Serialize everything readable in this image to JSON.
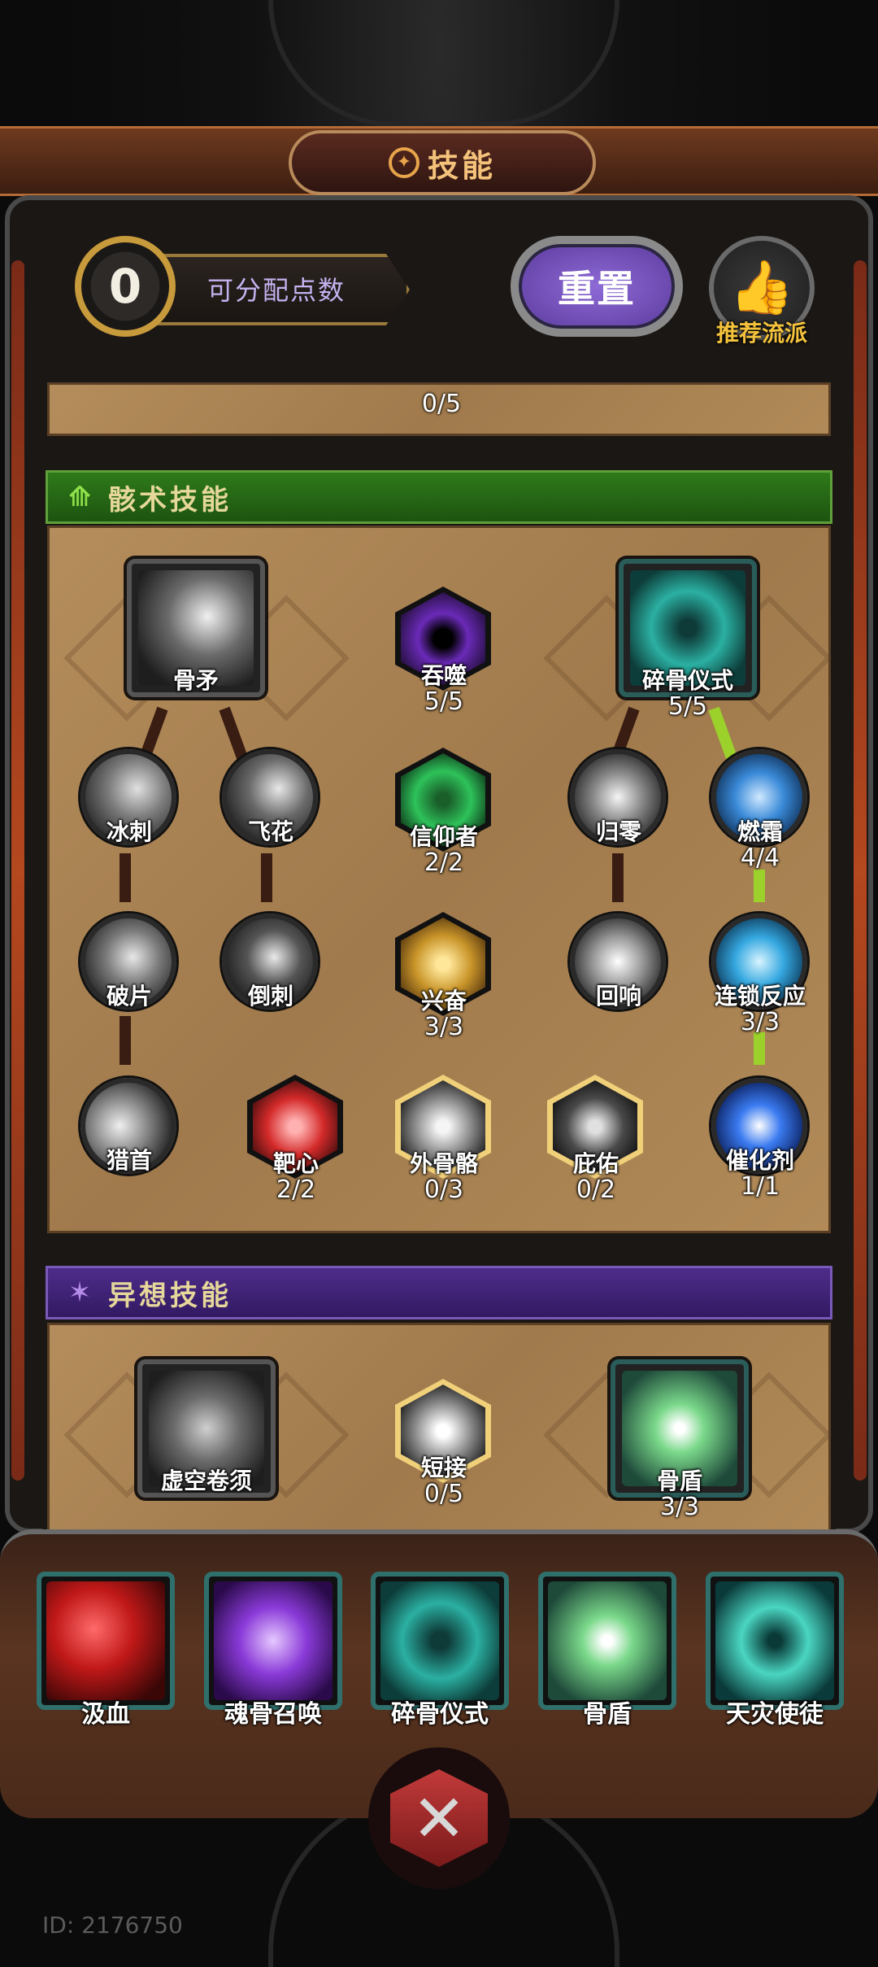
{
  "header": {
    "title": "技能",
    "title_icon": "pentagram-icon",
    "points_value": "0",
    "points_label": "可分配点数",
    "reset_label": "重置",
    "recommend_label": "推荐流派"
  },
  "top_strip": {
    "level": "0/5"
  },
  "sections": {
    "bone": {
      "title": "骸术技能",
      "color": "#2f7a1a",
      "nodes": {
        "bone_spear": {
          "name": "骨矛"
        },
        "devour": {
          "name": "吞噬",
          "level": "5/5"
        },
        "bone_ritual": {
          "name": "碎骨仪式",
          "level": "5/5"
        },
        "ice_spike": {
          "name": "冰刺"
        },
        "flying_flower": {
          "name": "飞花"
        },
        "believer": {
          "name": "信仰者",
          "level": "2/2"
        },
        "return_zero": {
          "name": "归零"
        },
        "burning_frost": {
          "name": "燃霜",
          "level": "4/4"
        },
        "shard": {
          "name": "破片"
        },
        "barb": {
          "name": "倒刺"
        },
        "excite": {
          "name": "兴奋",
          "level": "3/3"
        },
        "echo": {
          "name": "回响"
        },
        "chain_reaction": {
          "name": "连锁反应",
          "level": "3/3"
        },
        "hunter": {
          "name": "猎首"
        },
        "target": {
          "name": "靶心",
          "level": "2/2"
        },
        "exoskeleton": {
          "name": "外骨骼",
          "level": "0/3"
        },
        "bless": {
          "name": "庇佑",
          "level": "0/2"
        },
        "catalyst": {
          "name": "催化剂",
          "level": "1/1"
        }
      }
    },
    "fantasy": {
      "title": "异想技能",
      "color": "#4e2c8a",
      "nodes": {
        "void_scroll": {
          "name": "虚空卷须"
        },
        "short_link": {
          "name": "短接",
          "level": "0/5"
        },
        "bone_shield": {
          "name": "骨盾",
          "level": "3/3"
        }
      }
    }
  },
  "equipped": [
    {
      "name": "汲血"
    },
    {
      "name": "魂骨召唤"
    },
    {
      "name": "碎骨仪式"
    },
    {
      "name": "骨盾"
    },
    {
      "name": "天灾使徒"
    }
  ],
  "close_icon": "crossed-swords-icon",
  "footer": {
    "id_text": "ID: 2176750"
  }
}
